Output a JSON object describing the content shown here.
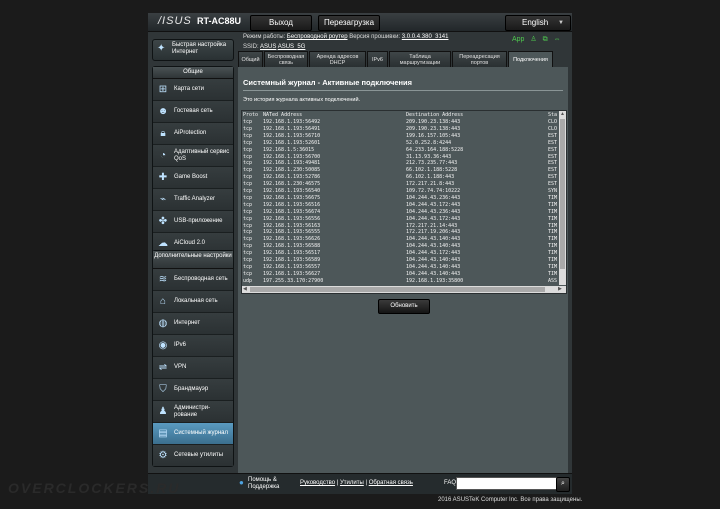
{
  "header": {
    "brand_logo": "/ISUS",
    "model": "RT-AC88U",
    "logout_label": "Выход",
    "reboot_label": "Перезагрузка",
    "language": "English"
  },
  "info": {
    "mode_label": "Режим работы:",
    "mode_value": "Беспроводной роутер",
    "firmware_label": "Версия прошивки:",
    "firmware_value": "3.0.0.4.380_3141",
    "ssid_label": "SSID:",
    "ssid_1": "ASUS",
    "ssid_2": "ASUS_5G",
    "app_label": "App"
  },
  "sidebar": {
    "quick_setup": "Быстрая настройка Интернет",
    "general_header": "Общие",
    "general_items": [
      {
        "label": "Карта сети"
      },
      {
        "label": "Гостевая сеть"
      },
      {
        "label": "AiProtection"
      },
      {
        "label": "Адаптивный сервис QoS"
      },
      {
        "label": "Game Boost"
      },
      {
        "label": "Traffic Analyzer"
      },
      {
        "label": "USB-приложение"
      },
      {
        "label": "AiCloud 2.0"
      }
    ],
    "advanced_header": "Дополнительные настройки",
    "advanced_items": [
      {
        "label": "Беспроводная сеть"
      },
      {
        "label": "Локальная сеть"
      },
      {
        "label": "Интернет"
      },
      {
        "label": "IPv6"
      },
      {
        "label": "VPN"
      },
      {
        "label": "Брандмауэр"
      },
      {
        "label": "Администри-рование"
      },
      {
        "label": "Системный журнал"
      },
      {
        "label": "Сетевые утилиты"
      }
    ]
  },
  "tabs": [
    {
      "label": "Общий"
    },
    {
      "label": "Беспроводная связь"
    },
    {
      "label": "Аренда адресов DHCP"
    },
    {
      "label": "IPv6"
    },
    {
      "label": "Таблица маршрутизации"
    },
    {
      "label": "Переадресация портов"
    },
    {
      "label": "Подключения"
    }
  ],
  "content": {
    "title": "Системный журнал - Активные подключения",
    "description": "Это история журнала активных подключений.",
    "refresh_label": "Обновить"
  },
  "log": {
    "headers": [
      "Proto",
      "NATed Address",
      "Destination Address",
      "State"
    ],
    "header_state_visible": "Sta",
    "rows": [
      [
        "tcp",
        "192.168.1.193:56492",
        "209.190.23.138:443",
        "CLO"
      ],
      [
        "tcp",
        "192.168.1.193:56491",
        "209.190.23.138:443",
        "CLO"
      ],
      [
        "tcp",
        "192.168.1.193:56710",
        "199.16.157.105:443",
        "EST"
      ],
      [
        "tcp",
        "192.168.1.193:52601",
        "52.0.252.8:4244",
        "EST"
      ],
      [
        "tcp",
        "192.168.1.5:36015",
        "64.233.164.188:5228",
        "EST"
      ],
      [
        "tcp",
        "192.168.1.193:56700",
        "31.13.93.36:443",
        "EST"
      ],
      [
        "tcp",
        "192.168.1.193:49481",
        "212.73.235.77:443",
        "EST"
      ],
      [
        "tcp",
        "192.168.1.230:50085",
        "66.102.1.188:5228",
        "EST"
      ],
      [
        "tcp",
        "192.168.1.193:52786",
        "66.102.1.188:443",
        "EST"
      ],
      [
        "tcp",
        "192.168.1.230:46575",
        "172.217.21.8:443",
        "EST"
      ],
      [
        "tcp",
        "192.168.1.193:56540",
        "109.72.74.74:10222",
        "SYN"
      ],
      [
        "tcp",
        "192.168.1.193:56675",
        "104.244.43.236:443",
        "TIM"
      ],
      [
        "tcp",
        "192.168.1.193:56516",
        "104.244.43.172:443",
        "TIM"
      ],
      [
        "tcp",
        "192.168.1.193:56674",
        "104.244.43.236:443",
        "TIM"
      ],
      [
        "tcp",
        "192.168.1.193:56556",
        "104.244.43.172:443",
        "TIM"
      ],
      [
        "tcp",
        "192.168.1.193:56163",
        "172.217.21.14:443",
        "TIM"
      ],
      [
        "tcp",
        "192.168.1.193:56555",
        "172.217.19.206:443",
        "TIM"
      ],
      [
        "tcp",
        "192.168.1.193:56626",
        "104.244.43.140:443",
        "TIM"
      ],
      [
        "tcp",
        "192.168.1.193:56588",
        "104.244.43.140:443",
        "TIM"
      ],
      [
        "tcp",
        "192.168.1.193:56517",
        "104.244.43.172:443",
        "TIM"
      ],
      [
        "tcp",
        "192.168.1.193:56589",
        "104.244.43.140:443",
        "TIM"
      ],
      [
        "tcp",
        "192.168.1.193:56557",
        "104.244.43.140:443",
        "TIM"
      ],
      [
        "tcp",
        "192.168.1.193:56627",
        "104.244.43.140:443",
        "TIM"
      ],
      [
        "udp",
        "197.255.33.170:27900",
        "192.168.1.193:35800",
        "ASS"
      ]
    ]
  },
  "footer": {
    "help_line1": "Помощь &",
    "help_line2": "Поддержка",
    "manual": "Руководство",
    "utilities": "Утилиты",
    "feedback": "Обратная связь",
    "separator": " | ",
    "faq": "FAQ"
  },
  "copyright": "2016 ASUSTeK Computer Inc. Все права защищены.",
  "watermark": "OVERCLOCKERS.RU",
  "colors": {
    "background": "#1b1b1b",
    "panel": "#303638",
    "content": "#4d5759",
    "selected": "#4a86ad",
    "icon_green": "#4ec94e"
  }
}
